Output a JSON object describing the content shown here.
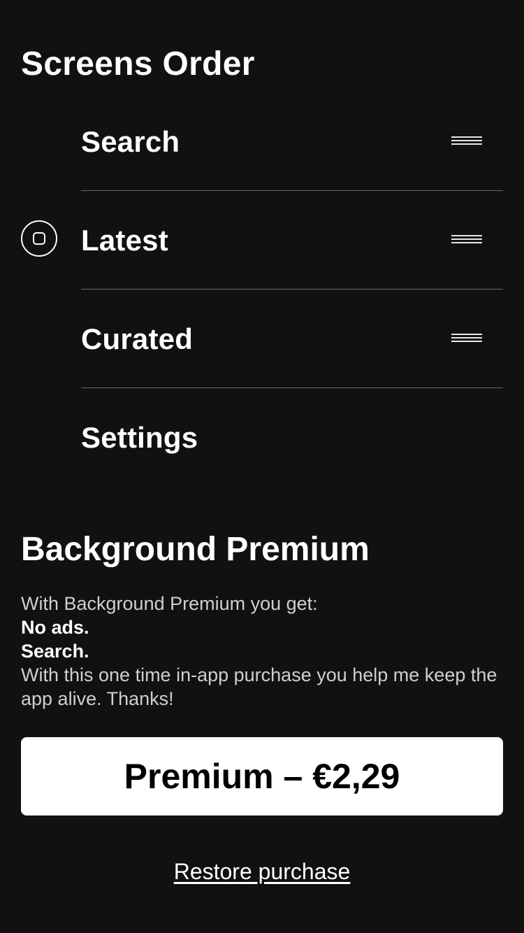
{
  "screens_order": {
    "title": "Screens Order",
    "items": [
      {
        "label": "Search",
        "has_handle": true,
        "is_home": false
      },
      {
        "label": "Latest",
        "has_handle": true,
        "is_home": true
      },
      {
        "label": "Curated",
        "has_handle": true,
        "is_home": false
      },
      {
        "label": "Settings",
        "has_handle": false,
        "is_home": false
      }
    ],
    "handle_icon": "drag-handle-icon",
    "home_icon": "home-button-icon"
  },
  "premium": {
    "title": "Background Premium",
    "intro": "With Background Premium you get:",
    "features": [
      "No ads.",
      "Search."
    ],
    "note": "With this one time in-app purchase you help me keep the app alive. Thanks!",
    "buy_label": "Premium – €2,29",
    "restore_label": "Restore purchase"
  },
  "colors": {
    "background": "#111111",
    "text": "#ffffff",
    "muted_text": "#cfcfcf",
    "divider": "#6a6a6a",
    "button_bg": "#ffffff",
    "button_text": "#000000"
  }
}
